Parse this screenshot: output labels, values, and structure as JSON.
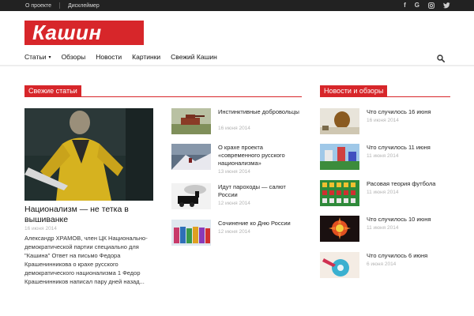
{
  "topbar": {
    "links": [
      "О проекте",
      "Дисклеймер"
    ],
    "social": [
      "facebook-icon",
      "google-icon",
      "instagram-icon",
      "twitter-icon"
    ]
  },
  "logo": {
    "text": "Кашин"
  },
  "nav": {
    "items": [
      "Статьи",
      "Обзоры",
      "Новости",
      "Картинки",
      "Свежий Кашин"
    ],
    "dropdown_caret": "▾"
  },
  "fresh": {
    "heading": "Свежие статьи",
    "featured": {
      "title": "Национализм — не тетка в вышиванке",
      "date": "16 июня 2014",
      "excerpt": "Александр ХРАМОВ, член ЦК Национально-демократической партии специально для \"Кашина\" Ответ на письмо Федора Крашенинникова о крахе русского демократического национализма 1 Федор Крашенинников написал пару дней назад..."
    },
    "list": [
      {
        "title": "Инстинктивные добровольцы",
        "date": "16 июня 2014"
      },
      {
        "title": "О крахе проекта «современного русского национализма»",
        "date": "13 июня 2014"
      },
      {
        "title": "Идут пароходы — салют России",
        "date": "12 июня 2014"
      },
      {
        "title": "Сочинение ко Дню России",
        "date": "12 июня 2014"
      }
    ]
  },
  "news": {
    "heading": "Новости и обзоры",
    "list": [
      {
        "title": "Что случилось 16 июня",
        "date": "16 июня 2014"
      },
      {
        "title": "Что случилось 11 июня",
        "date": "11 июня 2014"
      },
      {
        "title": "Расовая теория футбола",
        "date": "11 июня 2014"
      },
      {
        "title": "Что случилось 10 июня",
        "date": "11 июня 2014"
      },
      {
        "title": "Что случилось 6 июня",
        "date": "6 июня 2014"
      }
    ]
  }
}
